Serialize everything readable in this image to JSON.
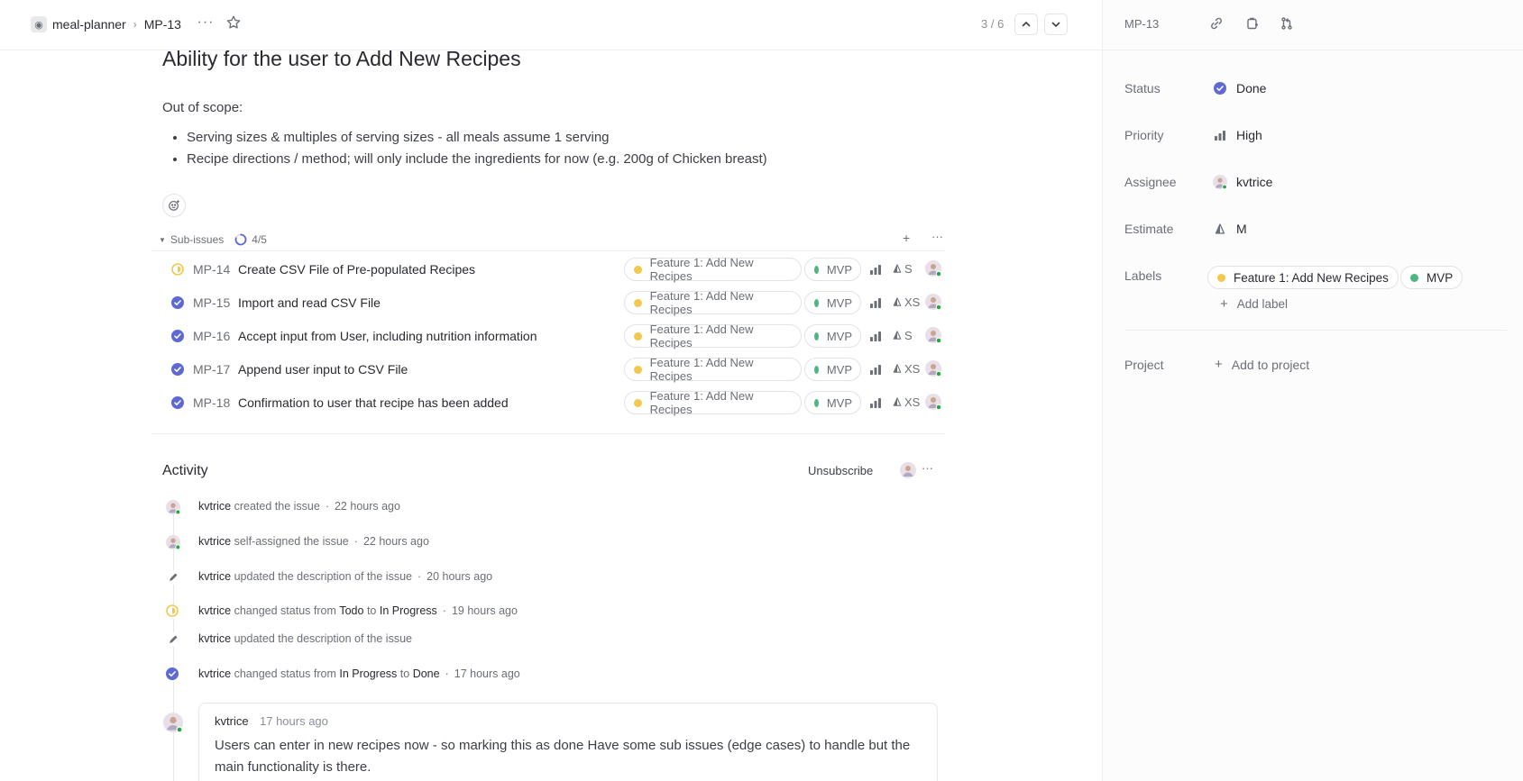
{
  "breadcrumb": {
    "team": "meal-planner",
    "team_icon": "plate-icon",
    "issue_id": "MP-13"
  },
  "pager": {
    "text": "3 / 6"
  },
  "issue": {
    "title": "Ability for the user to Add New Recipes",
    "description_intro": "Out of scope:",
    "description_bullets": [
      "Serving sizes & multiples of serving sizes - all meals assume 1 serving",
      "Recipe directions / method; will only include the ingredients for now (e.g. 200g of Chicken breast)"
    ]
  },
  "sub_issues": {
    "label": "Sub-issues",
    "progress_text": "4/5",
    "progress_fraction": 0.8,
    "items": [
      {
        "id": "MP-14",
        "title": "Create CSV File of Pre-populated Recipes",
        "status": "in-progress",
        "label": "Feature 1: Add New Recipes",
        "mvp": "MVP",
        "estimate": "S"
      },
      {
        "id": "MP-15",
        "title": "Import and read CSV File",
        "status": "done",
        "label": "Feature 1: Add New Recipes",
        "mvp": "MVP",
        "estimate": "XS"
      },
      {
        "id": "MP-16",
        "title": "Accept input from User, including nutrition information",
        "status": "done",
        "label": "Feature 1: Add New Recipes",
        "mvp": "MVP",
        "estimate": "S"
      },
      {
        "id": "MP-17",
        "title": "Append user input to CSV File",
        "status": "done",
        "label": "Feature 1: Add New Recipes",
        "mvp": "MVP",
        "estimate": "XS"
      },
      {
        "id": "MP-18",
        "title": "Confirmation to user that recipe has been added",
        "status": "done",
        "label": "Feature 1: Add New Recipes",
        "mvp": "MVP",
        "estimate": "XS"
      }
    ]
  },
  "activity": {
    "title": "Activity",
    "unsubscribe": "Unsubscribe",
    "events": [
      {
        "actor": "kvtrice",
        "text": "created the issue",
        "time": "22 hours ago"
      },
      {
        "actor": "kvtrice",
        "text": "self-assigned the issue",
        "time": "22 hours ago"
      },
      {
        "actor": "kvtrice",
        "text": "updated the description of the issue",
        "time": "20 hours ago"
      },
      {
        "actor": "kvtrice",
        "pre": "changed status from",
        "from": "Todo",
        "mid": "to",
        "to": "In Progress",
        "time": "19 hours ago"
      },
      {
        "actor": "kvtrice",
        "text": "updated the description of the issue"
      },
      {
        "actor": "kvtrice",
        "pre": "changed status from",
        "from": "In Progress",
        "mid": "to",
        "to": "Done",
        "time": "17 hours ago"
      }
    ],
    "comment": {
      "author": "kvtrice",
      "time": "17 hours ago",
      "body": "Users can enter in new recipes now - so marking this as done Have some sub issues (edge cases) to handle but the main functionality is there."
    }
  },
  "sidebar": {
    "issue_id": "MP-13",
    "status": {
      "label": "Status",
      "value": "Done"
    },
    "priority": {
      "label": "Priority",
      "value": "High"
    },
    "assignee": {
      "label": "Assignee",
      "value": "kvtrice"
    },
    "estimate": {
      "label": "Estimate",
      "value": "M"
    },
    "labels": {
      "label": "Labels",
      "items": [
        "Feature 1: Add New Recipes",
        "MVP"
      ],
      "add": "Add label"
    },
    "project": {
      "label": "Project",
      "add": "Add to project"
    }
  },
  "colors": {
    "done": "#5e6ad2",
    "in_progress": "#f2c94c",
    "feature_dot": "#f2c94c",
    "mvp_dot": "#4cb782",
    "online": "#27a644"
  }
}
